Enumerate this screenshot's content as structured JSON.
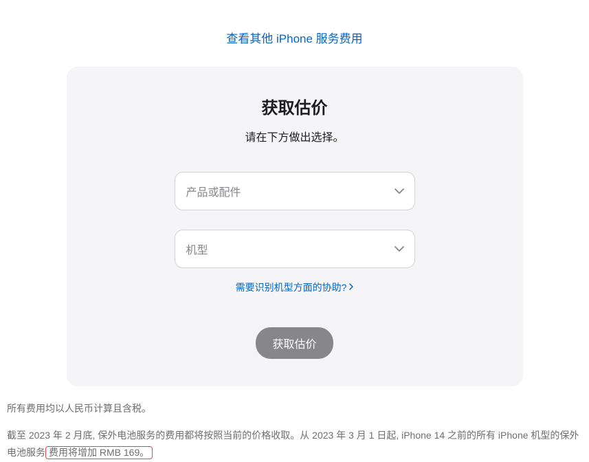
{
  "top_link": "查看其他 iPhone 服务费用",
  "card": {
    "title": "获取估价",
    "subtitle": "请在下方做出选择。",
    "select_product_placeholder": "产品或配件",
    "select_model_placeholder": "机型",
    "help_link": "需要识别机型方面的协助?",
    "submit_label": "获取估价"
  },
  "footer": {
    "line1": "所有费用均以人民币计算且含税。",
    "line2_part1": "截至 2023 年 2 月底, 保外电池服务的费用都将按照当前的价格收取。从 2023 年 3 月 1 日起, iPhone 14 之前的所有 iPhone 机型的保外电池服务",
    "line2_highlight": "费用将增加 RMB 169。"
  }
}
